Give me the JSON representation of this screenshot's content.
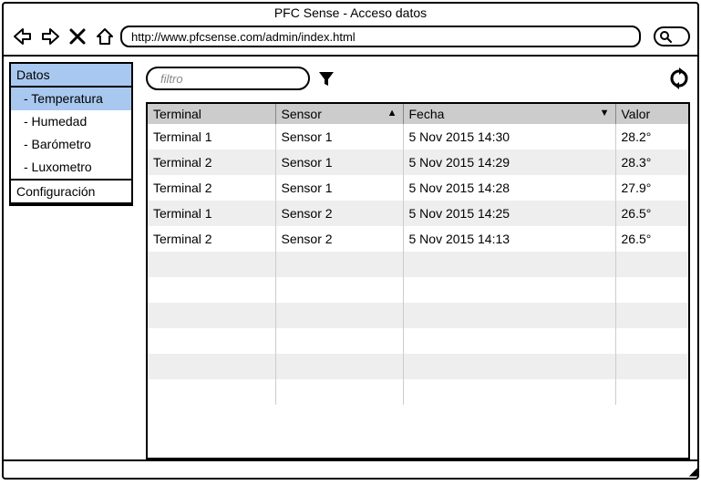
{
  "window": {
    "title": "PFC Sense - Acceso datos",
    "url": "http://www.pfcsense.com/admin/index.html"
  },
  "sidebar": {
    "groups": [
      {
        "header": "Datos",
        "header_selected": true,
        "items": [
          {
            "label": "- Temperatura",
            "selected": true
          },
          {
            "label": "- Humedad",
            "selected": false
          },
          {
            "label": "- Barómetro",
            "selected": false
          },
          {
            "label": "- Luxometro",
            "selected": false
          }
        ]
      },
      {
        "header": "Configuración",
        "header_selected": false,
        "items": []
      }
    ]
  },
  "filter": {
    "placeholder": "filtro",
    "value": ""
  },
  "table": {
    "columns": [
      {
        "label": "Terminal",
        "sort": ""
      },
      {
        "label": "Sensor",
        "sort": "▲"
      },
      {
        "label": "Fecha",
        "sort": "▼"
      },
      {
        "label": "Valor",
        "sort": ""
      }
    ],
    "rows": [
      {
        "terminal": "Terminal 1",
        "sensor": "Sensor 1",
        "fecha": "5 Nov 2015 14:30",
        "valor": "28.2°"
      },
      {
        "terminal": "Terminal 2",
        "sensor": "Sensor 1",
        "fecha": "5 Nov 2015 14:29",
        "valor": "28.3°"
      },
      {
        "terminal": "Terminal 2",
        "sensor": "Sensor 1",
        "fecha": "5 Nov 2015 14:28",
        "valor": "27.9°"
      },
      {
        "terminal": "Terminal 1",
        "sensor": "Sensor 2",
        "fecha": "5 Nov 2015 14:25",
        "valor": "26.5°"
      },
      {
        "terminal": "Terminal 2",
        "sensor": "Sensor 2",
        "fecha": "5 Nov 2015 14:13",
        "valor": "26.5°"
      }
    ],
    "empty_rows": 6
  }
}
